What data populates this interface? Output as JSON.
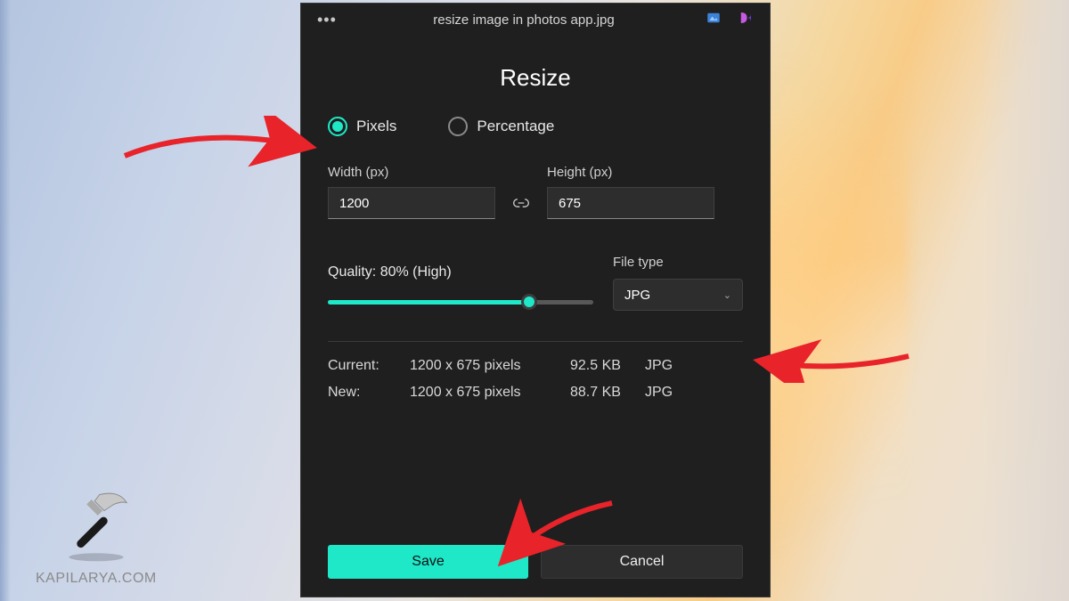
{
  "titlebar": {
    "filename": "resize image in photos app.jpg"
  },
  "heading": "Resize",
  "units": {
    "pixels_label": "Pixels",
    "percentage_label": "Percentage"
  },
  "dimensions": {
    "width_label": "Width (px)",
    "width_value": "1200",
    "height_label": "Height (px)",
    "height_value": "675"
  },
  "quality": {
    "label": "Quality: 80% (High)",
    "percent": 80
  },
  "filetype": {
    "label": "File type",
    "value": "JPG"
  },
  "info": {
    "current_label": "Current:",
    "current_dims": "1200 x 675 pixels",
    "current_size": "92.5 KB",
    "current_type": "JPG",
    "new_label": "New:",
    "new_dims": "1200 x 675 pixels",
    "new_size": "88.7 KB",
    "new_type": "JPG"
  },
  "buttons": {
    "save": "Save",
    "cancel": "Cancel"
  },
  "watermark": "KAPILARYA.COM"
}
